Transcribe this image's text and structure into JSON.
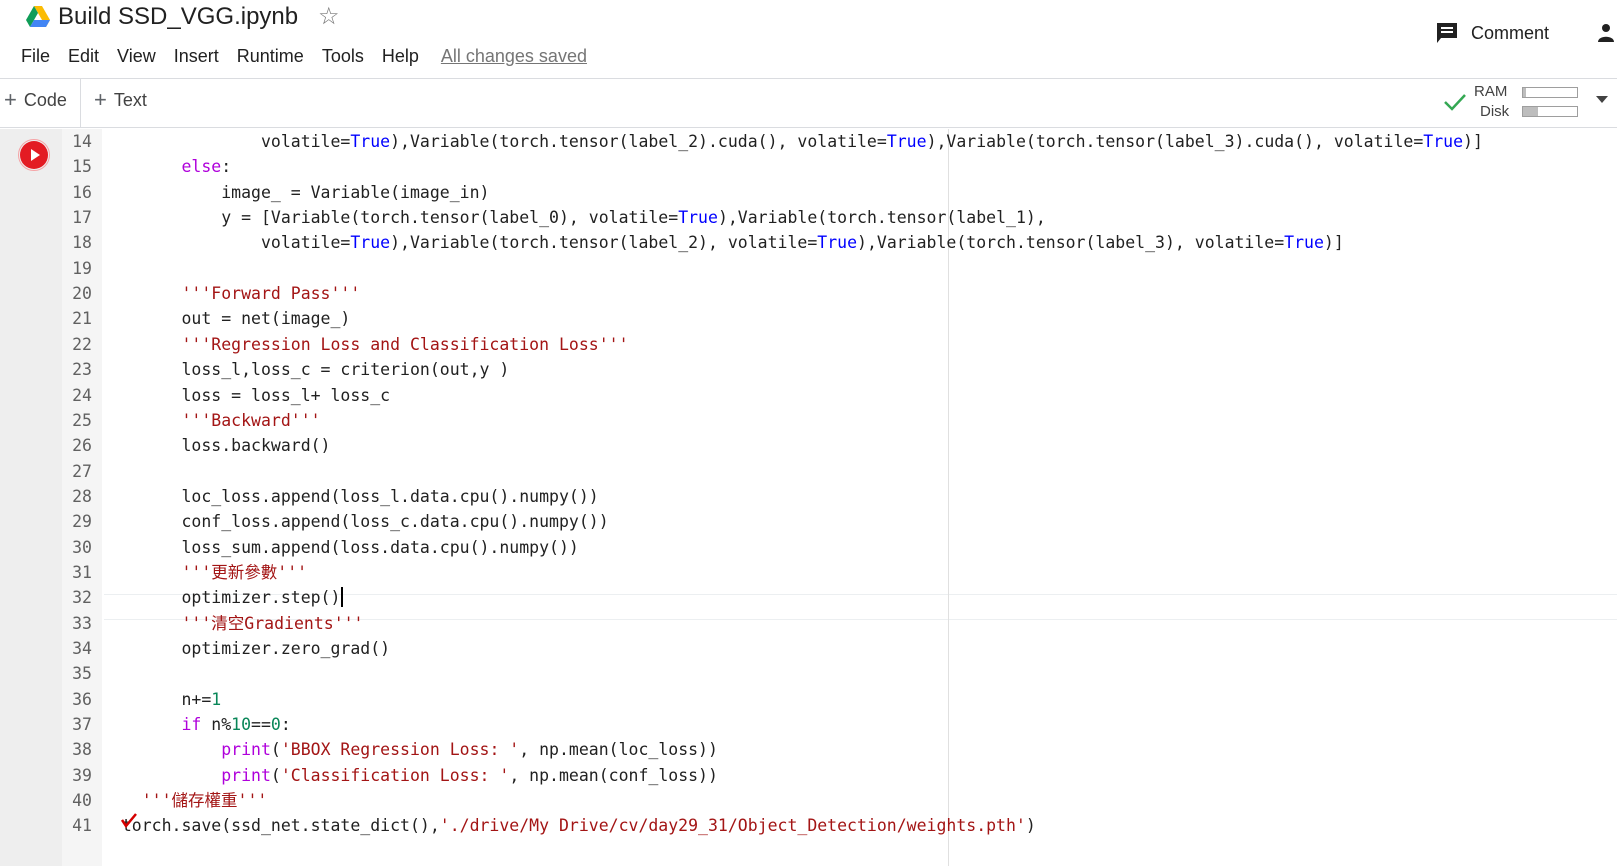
{
  "header": {
    "title": "Build SSD_VGG.ipynb",
    "menu": [
      "File",
      "Edit",
      "View",
      "Insert",
      "Runtime",
      "Tools",
      "Help"
    ],
    "save_status": "All changes saved",
    "comment_label": "Comment"
  },
  "toolbar": {
    "add_code_label": "Code",
    "add_text_label": "Text",
    "ram_label": "RAM",
    "disk_label": "Disk",
    "ram_usage": 0.06,
    "disk_usage": 0.28
  },
  "colors": {
    "run_button": "#e31b23",
    "keyword": "#af00db",
    "boolean": "#0000ff",
    "string": "#a31515",
    "number": "#098658",
    "connected_check": "#34a853"
  },
  "code_lines": [
    {
      "n": "14",
      "indent": 16,
      "tokens": [
        [
          "volatile=",
          "c"
        ],
        [
          "True",
          "b"
        ],
        [
          "),Variable(torch.tensor(label_2).cuda(), volatile=",
          "c"
        ],
        [
          "True",
          "b"
        ],
        [
          "),Variable(torch.tensor(label_3).cuda(), volatile=",
          "c"
        ],
        [
          "True",
          "b"
        ],
        [
          ")]",
          "c"
        ]
      ]
    },
    {
      "n": "15",
      "indent": 8,
      "tokens": [
        [
          "else",
          "k"
        ],
        [
          ":",
          "c"
        ]
      ]
    },
    {
      "n": "16",
      "indent": 12,
      "tokens": [
        [
          "image_ = Variable(image_in)",
          "c"
        ]
      ]
    },
    {
      "n": "17",
      "indent": 12,
      "tokens": [
        [
          "y = [Variable(torch.tensor(label_0), volatile=",
          "c"
        ],
        [
          "True",
          "b"
        ],
        [
          "),Variable(torch.tensor(label_1),",
          "c"
        ]
      ]
    },
    {
      "n": "18",
      "indent": 16,
      "tokens": [
        [
          "volatile=",
          "c"
        ],
        [
          "True",
          "b"
        ],
        [
          "),Variable(torch.tensor(label_2), volatile=",
          "c"
        ],
        [
          "True",
          "b"
        ],
        [
          "),Variable(torch.tensor(label_3), volatile=",
          "c"
        ],
        [
          "True",
          "b"
        ],
        [
          ")]",
          "c"
        ]
      ]
    },
    {
      "n": "19",
      "indent": 0,
      "tokens": []
    },
    {
      "n": "20",
      "indent": 8,
      "tokens": [
        [
          "'''Forward Pass'''",
          "s"
        ]
      ]
    },
    {
      "n": "21",
      "indent": 8,
      "tokens": [
        [
          "out = net(image_)",
          "c"
        ]
      ]
    },
    {
      "n": "22",
      "indent": 8,
      "tokens": [
        [
          "'''Regression Loss and Classification Loss'''",
          "s"
        ]
      ]
    },
    {
      "n": "23",
      "indent": 8,
      "tokens": [
        [
          "loss_l,loss_c = criterion(out,y )",
          "c"
        ]
      ]
    },
    {
      "n": "24",
      "indent": 8,
      "tokens": [
        [
          "loss = loss_l+ loss_c",
          "c"
        ]
      ]
    },
    {
      "n": "25",
      "indent": 8,
      "tokens": [
        [
          "'''Backward'''",
          "s"
        ]
      ]
    },
    {
      "n": "26",
      "indent": 8,
      "tokens": [
        [
          "loss.backward()",
          "c"
        ]
      ]
    },
    {
      "n": "27",
      "indent": 0,
      "tokens": []
    },
    {
      "n": "28",
      "indent": 8,
      "tokens": [
        [
          "loc_loss.append(loss_l.data.cpu().numpy())",
          "c"
        ]
      ]
    },
    {
      "n": "29",
      "indent": 8,
      "tokens": [
        [
          "conf_loss.append(loss_c.data.cpu().numpy())",
          "c"
        ]
      ]
    },
    {
      "n": "30",
      "indent": 8,
      "tokens": [
        [
          "loss_sum.append(loss.data.cpu().numpy())",
          "c"
        ]
      ]
    },
    {
      "n": "31",
      "indent": 8,
      "tokens": [
        [
          "'''更新參數'''",
          "s"
        ]
      ]
    },
    {
      "n": "32",
      "indent": 8,
      "tokens": [
        [
          "optimizer.step()",
          "c"
        ]
      ],
      "cursor": true
    },
    {
      "n": "33",
      "indent": 8,
      "tokens": [
        [
          "'''清空Gradients'''",
          "s"
        ]
      ]
    },
    {
      "n": "34",
      "indent": 8,
      "tokens": [
        [
          "optimizer.zero_grad()",
          "c"
        ]
      ]
    },
    {
      "n": "35",
      "indent": 0,
      "tokens": []
    },
    {
      "n": "36",
      "indent": 8,
      "tokens": [
        [
          "n+=",
          "c"
        ],
        [
          "1",
          "n"
        ]
      ]
    },
    {
      "n": "37",
      "indent": 8,
      "tokens": [
        [
          "if",
          "k"
        ],
        [
          " n%",
          "c"
        ],
        [
          "10",
          "n"
        ],
        [
          "==",
          "c"
        ],
        [
          "0",
          "n"
        ],
        [
          ":",
          "c"
        ]
      ]
    },
    {
      "n": "38",
      "indent": 12,
      "tokens": [
        [
          "print",
          "k"
        ],
        [
          "(",
          "c"
        ],
        [
          "'BBOX Regression Loss: '",
          "s"
        ],
        [
          ", np.mean(loc_loss))",
          "c"
        ]
      ]
    },
    {
      "n": "39",
      "indent": 12,
      "tokens": [
        [
          "print",
          "k"
        ],
        [
          "(",
          "c"
        ],
        [
          "'Classification Loss: '",
          "s"
        ],
        [
          ", np.mean(conf_loss))",
          "c"
        ]
      ]
    },
    {
      "n": "40",
      "indent": 4,
      "tokens": [
        [
          "'''儲存權重'''",
          "s"
        ]
      ]
    },
    {
      "n": "41",
      "indent": 2,
      "tokens": [
        [
          "torch.save(ssd_net.state_dict(),",
          "c"
        ],
        [
          "'./drive/My Drive/cv/day29_31/Object_Detection/weights.pth'",
          "s"
        ],
        [
          ")",
          "c"
        ]
      ]
    }
  ]
}
